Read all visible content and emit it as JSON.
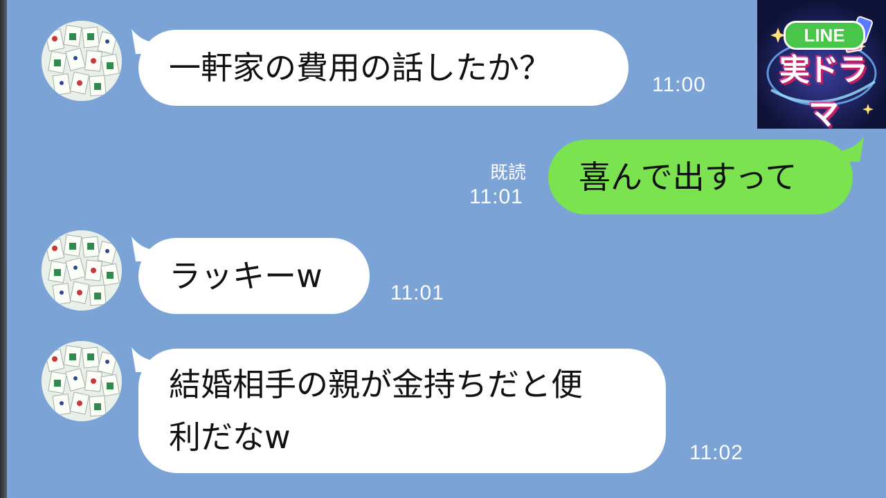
{
  "colors": {
    "background": "#7ca3d6",
    "outgoing_bubble": "#7be34f",
    "incoming_bubble": "#ffffff"
  },
  "logo": {
    "badge_text": "LINE",
    "title": "実ドラマ"
  },
  "messages": [
    {
      "direction": "incoming",
      "text": "一軒家の費用の話したか？",
      "time": "11:00"
    },
    {
      "direction": "outgoing",
      "text": "喜んで出すって",
      "time": "11:01",
      "read_label": "既読"
    },
    {
      "direction": "incoming",
      "text": "ラッキーw",
      "time": "11:01"
    },
    {
      "direction": "incoming",
      "text": "結婚相手の親が金持ちだと便\n利だなw",
      "time": "11:02"
    }
  ]
}
